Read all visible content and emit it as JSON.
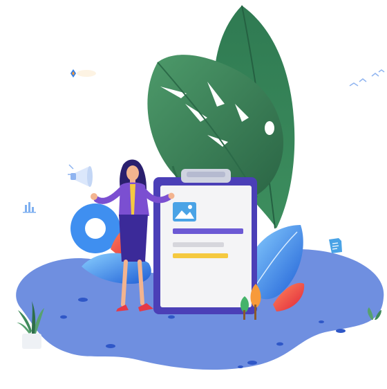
{
  "illustration": {
    "colors": {
      "ground": "#6f8fe0",
      "ground_dots": "#2f57c7",
      "leaf_dark": "#2e6e4a",
      "leaf_mid": "#3f8a5b",
      "leaf_light": "#57a16f",
      "clipboard_frame": "#4b3fb7",
      "clipboard_paper": "#f4f4f6",
      "clip": "#cfd3e0",
      "image_icon": "#4aa3e6",
      "line_primary": "#6c59d4",
      "line_gray": "#d6d6dc",
      "line_yellow": "#f5c940",
      "jacket": "#7b4fd1",
      "skirt": "#3b2a99",
      "hair": "#2a1f6e",
      "shoes": "#e63946",
      "ring": "#3f8ff0",
      "blue_leaf": "#2f7ee8",
      "red_leaf": "#ef4a4a",
      "orange_leaf": "#f79a3a"
    },
    "icons": [
      "megaphone-icon",
      "image-icon",
      "bar-chart-icon",
      "document-icon",
      "bird-icon",
      "diamond-sparkle-icon"
    ]
  }
}
